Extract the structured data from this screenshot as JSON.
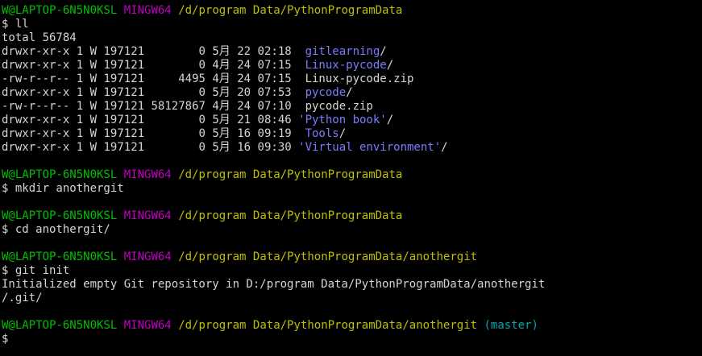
{
  "colors": {
    "background": "#000000",
    "text": "#d3d7cf",
    "user_host": "#00bf00",
    "msystem": "#bf00bf",
    "path": "#bfbf00",
    "branch": "#00a6b2",
    "directory": "#7b7bff"
  },
  "prompt": {
    "user_host": "W@LAPTOP-6N5N0KSL",
    "msystem": "MINGW64"
  },
  "blocks": [
    {
      "path": "/d/program Data/PythonProgramData",
      "command": "$ ll",
      "output": [
        "total 56784"
      ],
      "listing": [
        {
          "perms": "drwxr-xr-x",
          "links": "1",
          "owner": "W",
          "group": "197121",
          "size": "0",
          "month": "5月",
          "day": "22",
          "time": "02:18",
          "name": "gitlearning",
          "suffix": "/",
          "type": "dir"
        },
        {
          "perms": "drwxr-xr-x",
          "links": "1",
          "owner": "W",
          "group": "197121",
          "size": "0",
          "month": "4月",
          "day": "24",
          "time": "07:15",
          "name": "Linux-pycode",
          "suffix": "/",
          "type": "dir"
        },
        {
          "perms": "-rw-r--r--",
          "links": "1",
          "owner": "W",
          "group": "197121",
          "size": "4495",
          "month": "4月",
          "day": "24",
          "time": "07:15",
          "name": "Linux-pycode.zip",
          "suffix": "",
          "type": "file"
        },
        {
          "perms": "drwxr-xr-x",
          "links": "1",
          "owner": "W",
          "group": "197121",
          "size": "0",
          "month": "5月",
          "day": "20",
          "time": "07:53",
          "name": "pycode",
          "suffix": "/",
          "type": "dir"
        },
        {
          "perms": "-rw-r--r--",
          "links": "1",
          "owner": "W",
          "group": "197121",
          "size": "58127867",
          "month": "4月",
          "day": "24",
          "time": "07:10",
          "name": "pycode.zip",
          "suffix": "",
          "type": "file"
        },
        {
          "perms": "drwxr-xr-x",
          "links": "1",
          "owner": "W",
          "group": "197121",
          "size": "0",
          "month": "5月",
          "day": "21",
          "time": "08:46",
          "name": "'Python book'",
          "suffix": "/",
          "type": "dir"
        },
        {
          "perms": "drwxr-xr-x",
          "links": "1",
          "owner": "W",
          "group": "197121",
          "size": "0",
          "month": "5月",
          "day": "16",
          "time": "09:19",
          "name": "Tools",
          "suffix": "/",
          "type": "dir"
        },
        {
          "perms": "drwxr-xr-x",
          "links": "1",
          "owner": "W",
          "group": "197121",
          "size": "0",
          "month": "5月",
          "day": "16",
          "time": "09:30",
          "name": "'Virtual environment'",
          "suffix": "/",
          "type": "dir"
        }
      ]
    },
    {
      "path": "/d/program Data/PythonProgramData",
      "command": "$ mkdir anothergit",
      "output": []
    },
    {
      "path": "/d/program Data/PythonProgramData",
      "command": "$ cd anothergit/",
      "output": []
    },
    {
      "path": "/d/program Data/PythonProgramData/anothergit",
      "command": "$ git init",
      "output": [
        "Initialized empty Git repository in D:/program Data/PythonProgramData/anothergit",
        "/.git/"
      ]
    },
    {
      "path": "/d/program Data/PythonProgramData/anothergit",
      "branch": "(master)",
      "command": "$",
      "output": []
    }
  ]
}
